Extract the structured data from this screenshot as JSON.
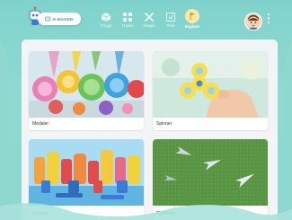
{
  "app": {
    "logo_text": "H-MAKER"
  },
  "nav": {
    "items": [
      {
        "label": "Things",
        "icon": "cube-icon"
      },
      {
        "label": "Tracks",
        "icon": "grid-icon"
      },
      {
        "label": "Swaps",
        "icon": "tools-icon"
      },
      {
        "label": "Print",
        "icon": "print-icon"
      },
      {
        "label": "Explore",
        "icon": "flag-icon",
        "active": true
      }
    ]
  },
  "cards": [
    {
      "title": "Medaler",
      "image": "medals-image"
    },
    {
      "title": "Spinner",
      "image": "fidget-spinner-image"
    },
    {
      "title": "Wonder",
      "image": "toy-figures-image"
    },
    {
      "title": "FlyMaker",
      "image": "paper-planes-image"
    }
  ],
  "colors": {
    "header_bg": "#7fd3cc",
    "content_bg": "#f2f4f6",
    "explore_highlight": "#fbe9a8"
  }
}
